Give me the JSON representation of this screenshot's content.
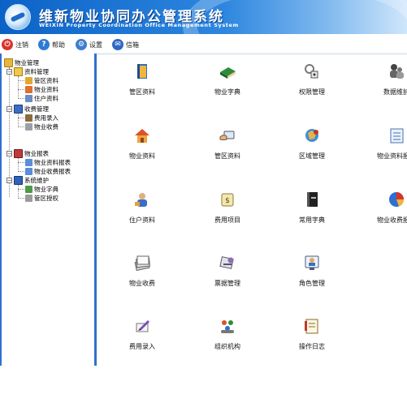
{
  "header": {
    "title_cn": "维新物业协同办公管理系统",
    "title_en": "WEIXIN Property Coordination Office Management System"
  },
  "toolbar": {
    "logout": "注销",
    "help": "帮助",
    "settings": "设置",
    "messages": "信箱"
  },
  "sidebar": {
    "root": "物业管理",
    "groups": [
      {
        "label": "资料管理",
        "children": [
          "管区资料",
          "物业资料",
          "住户资料"
        ]
      },
      {
        "label": "收费管理",
        "children": [
          "费用录入",
          "物业收费"
        ]
      },
      {
        "label": "物业报表",
        "children": [
          "物业资料报表",
          "物业收费报表"
        ]
      },
      {
        "label": "系统维护",
        "children": [
          "物业字典",
          "管区授权"
        ]
      }
    ]
  },
  "grid": [
    {
      "label": "管区资料",
      "icon": "book-icon"
    },
    {
      "label": "物业字典",
      "icon": "dictionary-icon"
    },
    {
      "label": "权限管理",
      "icon": "key-icon"
    },
    {
      "label": "数据维护",
      "icon": "users-icon"
    },
    {
      "label": "物业资料",
      "icon": "house-icon"
    },
    {
      "label": "管区资料",
      "icon": "card-hand-icon"
    },
    {
      "label": "区域管理",
      "icon": "region-icon"
    },
    {
      "label": "物业资料报表",
      "icon": "report-icon"
    },
    {
      "label": "住户资料",
      "icon": "resident-icon"
    },
    {
      "label": "费用项目",
      "icon": "money-icon"
    },
    {
      "label": "常用字典",
      "icon": "black-book-icon"
    },
    {
      "label": "物业收费报表",
      "icon": "pie-chart-icon"
    },
    {
      "label": "物业收费",
      "icon": "papers-icon"
    },
    {
      "label": "票据管理",
      "icon": "bills-icon"
    },
    {
      "label": "角色管理",
      "icon": "role-icon"
    },
    {
      "label": "费用录入",
      "icon": "pen-icon"
    },
    {
      "label": "组织机构",
      "icon": "organization-icon"
    },
    {
      "label": "操作日志",
      "icon": "log-icon"
    }
  ]
}
